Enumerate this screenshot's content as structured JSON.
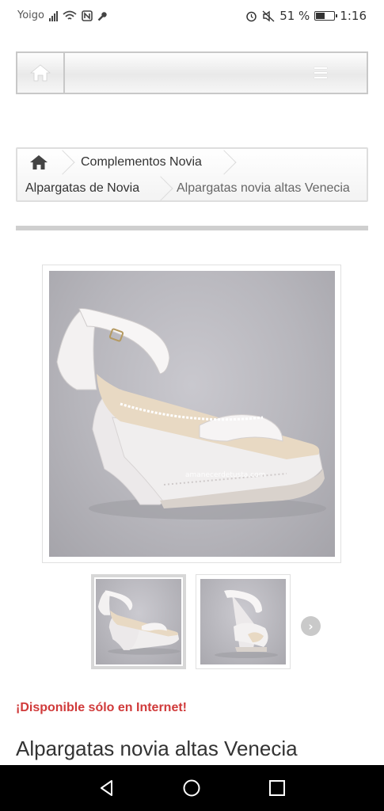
{
  "status_bar": {
    "carrier": "Yoigo",
    "battery": "51 %",
    "battery_level": 0.51,
    "time": "1:16",
    "icons": [
      "signal-icon",
      "wifi-icon",
      "nfc-icon",
      "wrench-icon",
      "alarm-icon",
      "mute-icon",
      "battery-icon"
    ]
  },
  "header": {
    "home_icon": "home-icon",
    "menu_icon": "hamburger-menu-icon"
  },
  "breadcrumb": {
    "items": [
      {
        "label": "Complementos Novia"
      },
      {
        "label": "Alpargatas de Novia"
      },
      {
        "label": "Alpargatas novia altas Venecia"
      }
    ]
  },
  "product": {
    "image_watermark": "amanecerdetusta.com",
    "availability": "¡Disponible sólo en Internet!",
    "title": "Alpargatas novia altas Venecia"
  },
  "colors": {
    "availability": "#d03a3a",
    "background": "#ffffff"
  },
  "nav_bar": {
    "buttons": [
      "back-icon",
      "home-circle-icon",
      "recents-square-icon"
    ]
  }
}
